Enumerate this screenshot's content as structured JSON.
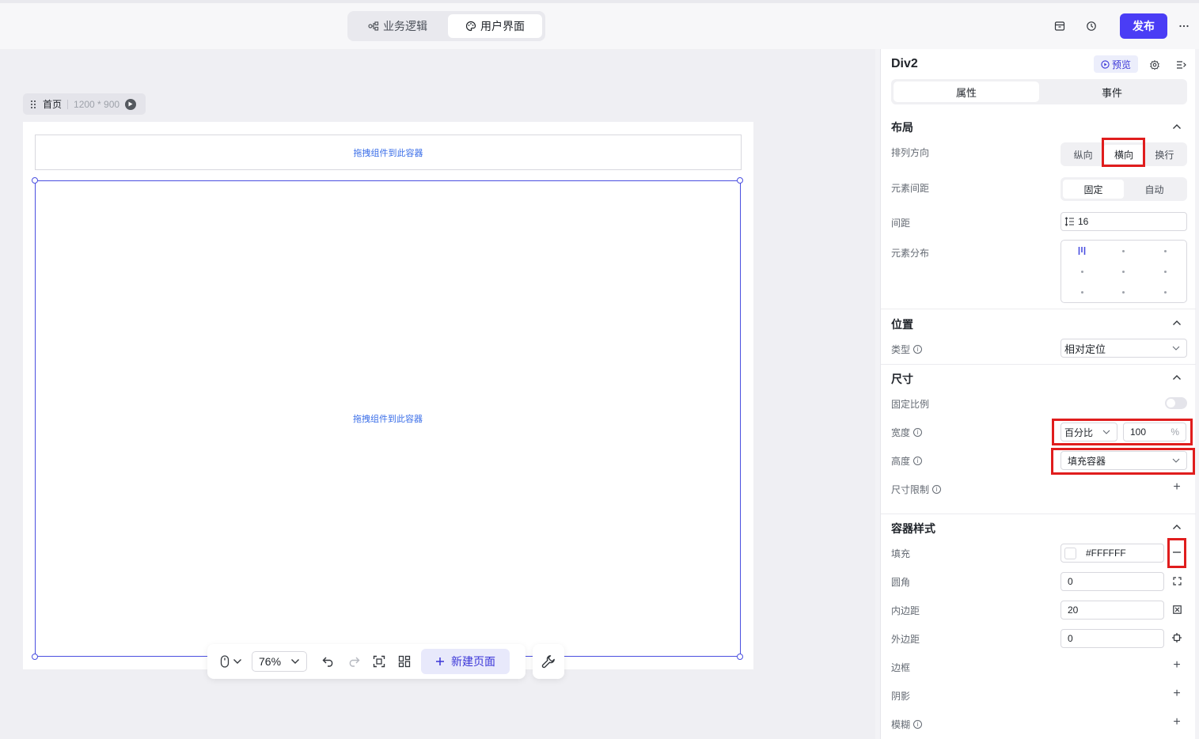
{
  "topbar": {
    "tabs": [
      {
        "label": "业务逻辑",
        "icon": "flow-icon"
      },
      {
        "label": "用户界面",
        "icon": "palette-icon"
      }
    ],
    "publish_label": "发布"
  },
  "canvas": {
    "page_name": "首页",
    "page_size": "1200 * 900",
    "drop_hint_1": "拖拽组件到此容器",
    "drop_hint_2": "拖拽组件到此容器"
  },
  "toolbar": {
    "zoom": "76%",
    "new_page_label": "新建页面"
  },
  "panel": {
    "title": "Div2",
    "preview_label": "预览",
    "tabs": [
      "属性",
      "事件"
    ],
    "layout": {
      "title": "布局",
      "direction_label": "排列方向",
      "direction_options": [
        "纵向",
        "横向",
        "换行"
      ],
      "spacing_mode_label": "元素间距",
      "spacing_mode_options": [
        "固定",
        "自动"
      ],
      "gap_label": "间距",
      "gap_value": "16",
      "distribution_label": "元素分布"
    },
    "position": {
      "title": "位置",
      "type_label": "类型",
      "type_value": "相对定位"
    },
    "size": {
      "title": "尺寸",
      "ratio_label": "固定比例",
      "width_label": "宽度",
      "width_unit": "百分比",
      "width_value": "100",
      "width_suffix": "%",
      "height_label": "高度",
      "height_value": "填充容器",
      "limit_label": "尺寸限制"
    },
    "container_style": {
      "title": "容器样式",
      "fill_label": "填充",
      "fill_value": "#FFFFFF",
      "radius_label": "圆角",
      "radius_value": "0",
      "padding_label": "内边距",
      "padding_value": "20",
      "margin_label": "外边距",
      "margin_value": "0",
      "border_label": "边框",
      "shadow_label": "阴影",
      "blur_label": "模糊"
    }
  },
  "colors": {
    "accent": "#4a3df5",
    "selection": "#4a4fe0",
    "highlight": "#e01d1d"
  }
}
